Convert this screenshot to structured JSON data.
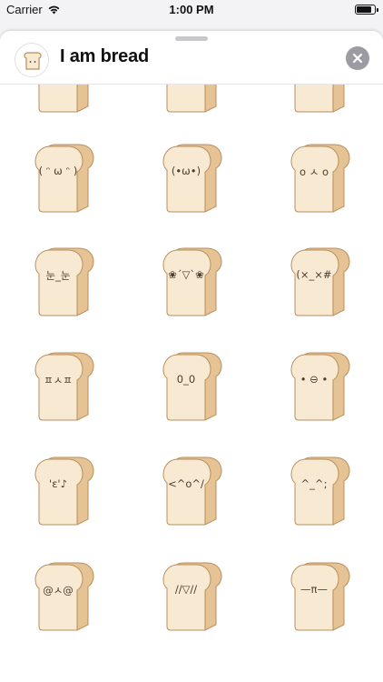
{
  "status_bar": {
    "carrier": "Carrier",
    "time": "1:00 PM",
    "battery_level": 0.85
  },
  "header": {
    "title": "I am bread",
    "app_icon": "bread-icon",
    "close_icon": "close-icon"
  },
  "stickers": [
    {
      "face": ""
    },
    {
      "face": ""
    },
    {
      "face": "^"
    },
    {
      "face": "( ᵔ ω ᵔ )"
    },
    {
      "face": "(•ω•)"
    },
    {
      "face": "o ㅅ o"
    },
    {
      "face": "눈_눈"
    },
    {
      "face": "❀´▽`❀"
    },
    {
      "face": "(×_×#"
    },
    {
      "face": "ㅍㅅㅍ"
    },
    {
      "face": "0_0"
    },
    {
      "face": "• ⊖ •"
    },
    {
      "face": "'ε'♪"
    },
    {
      "face": "<^o^/"
    },
    {
      "face": "^_^;"
    },
    {
      "face": "@ㅅ@"
    },
    {
      "face": "//▽//"
    },
    {
      "face": "—π—"
    }
  ],
  "colors": {
    "crust": "#e6c394",
    "crumb": "#f8ead2",
    "outline": "#b98e5c",
    "face_text": "#4a3d2e"
  }
}
